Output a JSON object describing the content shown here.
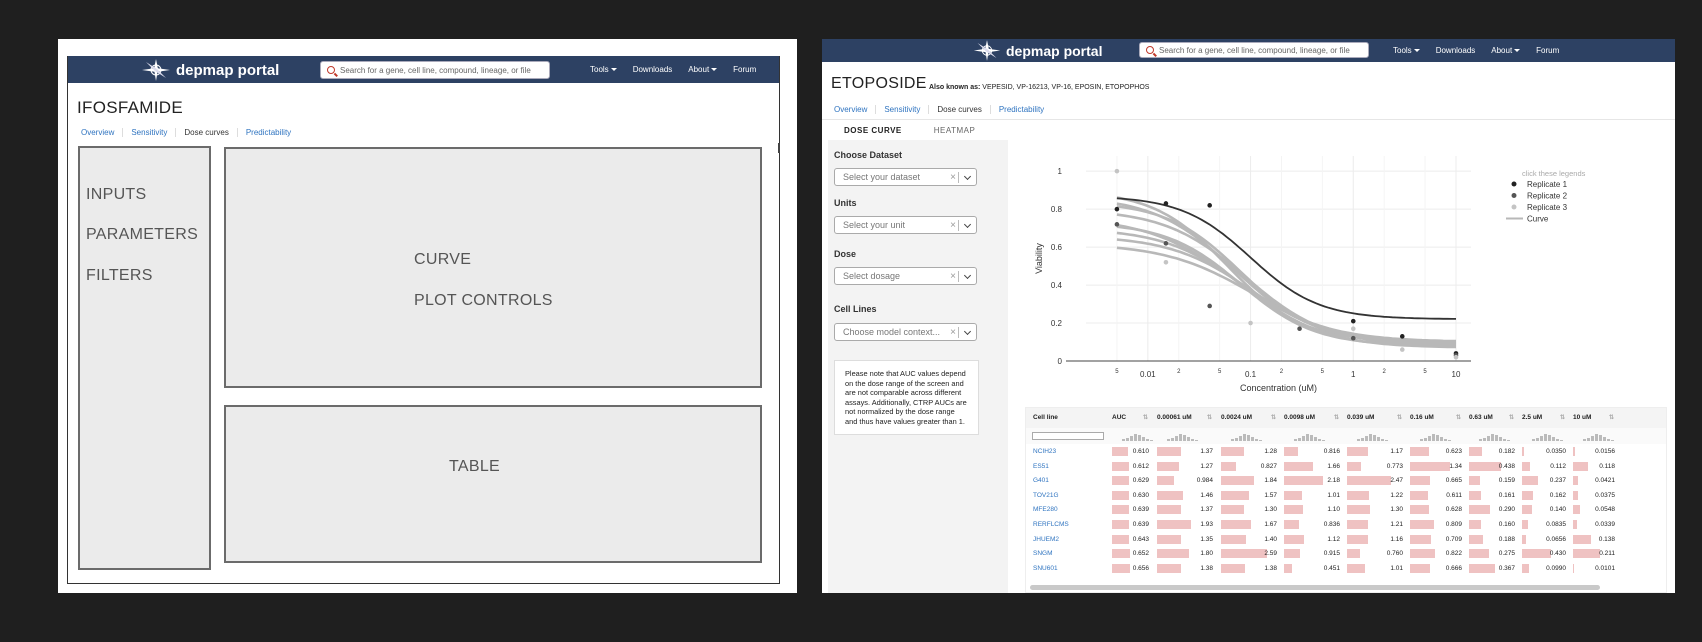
{
  "left": {
    "brand": "depmap portal",
    "search_placeholder": "Search for a gene, cell line, compound, lineage, or file",
    "nav": [
      "Tools",
      "Downloads",
      "About",
      "Forum"
    ],
    "title": "IFOSFAMIDE",
    "tabs": [
      "Overview",
      "Sensitivity",
      "Dose curves",
      "Predictability"
    ],
    "active_tab": "Dose curves",
    "wireframe": {
      "sidebar_labels": [
        "INPUTS",
        "PARAMETERS",
        "FILTERS"
      ],
      "curve_labels": [
        "CURVE",
        "PLOT CONTROLS"
      ],
      "table_label": "TABLE"
    }
  },
  "right": {
    "brand": "depmap portal",
    "search_placeholder": "Search for a gene, cell line, compound, lineage, or file",
    "nav": [
      "Tools",
      "Downloads",
      "About",
      "Forum"
    ],
    "title": "ETOPOSIDE",
    "also_known_label": "Also known as:",
    "also_known_value": "VEPESID, VP-16213, VP-16, EPOSIN, ETOPOPHOS",
    "tabs": [
      "Overview",
      "Sensitivity",
      "Dose curves",
      "Predictability"
    ],
    "subtabs": [
      "DOSE CURVE",
      "HEATMAP"
    ],
    "fields": [
      {
        "label": "Choose Dataset",
        "placeholder": "Select your dataset"
      },
      {
        "label": "Units",
        "placeholder": "Select your unit"
      },
      {
        "label": "Dose",
        "placeholder": "Select dosage"
      },
      {
        "label": "Cell Lines",
        "placeholder": "Choose model context..."
      }
    ],
    "note": "Please note that AUC values depend on the dose range of the screen and are not comparable across different assays. Additionally, CTRP AUCs are not normalized by the dose range and thus have values greater than 1.",
    "table": {
      "headers": [
        "Cell line",
        "AUC",
        "0.00061 uM",
        "0.0024 uM",
        "0.0098 uM",
        "0.039 uM",
        "0.16 uM",
        "0.63 uM",
        "2.5 uM",
        "10 uM"
      ],
      "rows": [
        {
          "name": "NCIH23",
          "values": [
            "0.610",
            "1.37",
            "1.28",
            "0.816",
            "1.17",
            "0.623",
            "0.182",
            "0.0350",
            "0.0156"
          ]
        },
        {
          "name": "ES51",
          "values": [
            "0.612",
            "1.27",
            "0.827",
            "1.66",
            "0.773",
            "1.34",
            "0.438",
            "0.112",
            "0.118"
          ]
        },
        {
          "name": "G401",
          "values": [
            "0.629",
            "0.984",
            "1.84",
            "2.18",
            "2.47",
            "0.665",
            "0.159",
            "0.237",
            "0.0421"
          ]
        },
        {
          "name": "TOV21G",
          "values": [
            "0.630",
            "1.46",
            "1.57",
            "1.01",
            "1.22",
            "0.611",
            "0.161",
            "0.162",
            "0.0375"
          ]
        },
        {
          "name": "MFE280",
          "values": [
            "0.639",
            "1.37",
            "1.30",
            "1.10",
            "1.30",
            "0.628",
            "0.290",
            "0.140",
            "0.0548"
          ]
        },
        {
          "name": "RERFLCMS",
          "values": [
            "0.639",
            "1.93",
            "1.67",
            "0.836",
            "1.21",
            "0.809",
            "0.160",
            "0.0835",
            "0.0339"
          ]
        },
        {
          "name": "JHUEM2",
          "values": [
            "0.643",
            "1.35",
            "1.40",
            "1.12",
            "1.16",
            "0.709",
            "0.188",
            "0.0656",
            "0.138"
          ]
        },
        {
          "name": "SNGM",
          "values": [
            "0.652",
            "1.80",
            "2.59",
            "0.915",
            "0.760",
            "0.822",
            "0.275",
            "0.430",
            "0.211"
          ]
        },
        {
          "name": "SNU601",
          "values": [
            "0.656",
            "1.38",
            "1.38",
            "0.451",
            "1.01",
            "0.666",
            "0.367",
            "0.0990",
            "0.0101"
          ]
        }
      ]
    }
  },
  "chart_data": {
    "type": "line",
    "title": "",
    "xlabel": "Concentration (uM)",
    "ylabel": "Viability",
    "x_scale": "log",
    "xlim": [
      0.0025,
      14
    ],
    "ylim": [
      0,
      1.08
    ],
    "y_ticks": [
      "0",
      "0.2",
      "0.4",
      "0.6",
      "0.8",
      "1"
    ],
    "x_major_ticks": [
      "0.01",
      "0.1",
      "1",
      "10"
    ],
    "x_minor_labels": [
      "5",
      "2",
      "5",
      "2",
      "5",
      "2",
      "5"
    ],
    "legend_hint": "click these legends",
    "legend": [
      "Replicate 1",
      "Replicate 2",
      "Replicate 3",
      "Curve"
    ],
    "legend_position": "top-right",
    "grid": true,
    "curves": [
      {
        "top": 0.87,
        "bottom": 0.22,
        "ec50": 0.1,
        "hill": 1.3,
        "highlight": true
      },
      {
        "top": 0.9,
        "bottom": 0.1,
        "ec50": 0.06,
        "hill": 1.2
      },
      {
        "top": 0.87,
        "bottom": 0.09,
        "ec50": 0.07,
        "hill": 1.1
      },
      {
        "top": 0.84,
        "bottom": 0.1,
        "ec50": 0.08,
        "hill": 1.2
      },
      {
        "top": 0.8,
        "bottom": 0.08,
        "ec50": 0.09,
        "hill": 1.1
      },
      {
        "top": 0.76,
        "bottom": 0.1,
        "ec50": 0.07,
        "hill": 1.0
      },
      {
        "top": 0.73,
        "bottom": 0.08,
        "ec50": 0.08,
        "hill": 1.2
      },
      {
        "top": 0.7,
        "bottom": 0.07,
        "ec50": 0.09,
        "hill": 1.1
      },
      {
        "top": 0.66,
        "bottom": 0.09,
        "ec50": 0.1,
        "hill": 1.1
      },
      {
        "top": 0.62,
        "bottom": 0.08,
        "ec50": 0.11,
        "hill": 1.0
      }
    ],
    "points": [
      {
        "x": 0.005,
        "y": 1.0,
        "rep": 3
      },
      {
        "x": 0.005,
        "y": 0.8,
        "rep": 1
      },
      {
        "x": 0.005,
        "y": 0.72,
        "rep": 2
      },
      {
        "x": 0.015,
        "y": 0.83,
        "rep": 1
      },
      {
        "x": 0.015,
        "y": 0.62,
        "rep": 2
      },
      {
        "x": 0.015,
        "y": 0.52,
        "rep": 3
      },
      {
        "x": 0.04,
        "y": 0.82,
        "rep": 1
      },
      {
        "x": 0.04,
        "y": 0.29,
        "rep": 2
      },
      {
        "x": 0.1,
        "y": 0.2,
        "rep": 3
      },
      {
        "x": 0.3,
        "y": 0.17,
        "rep": 2
      },
      {
        "x": 1.0,
        "y": 0.21,
        "rep": 1
      },
      {
        "x": 1.0,
        "y": 0.17,
        "rep": 3
      },
      {
        "x": 1.0,
        "y": 0.12,
        "rep": 2
      },
      {
        "x": 3.0,
        "y": 0.13,
        "rep": 1
      },
      {
        "x": 3.0,
        "y": 0.06,
        "rep": 3
      },
      {
        "x": 10.0,
        "y": 0.04,
        "rep": 1
      },
      {
        "x": 10.0,
        "y": 0.03,
        "rep": 2
      },
      {
        "x": 10.0,
        "y": 0.02,
        "rep": 3
      }
    ],
    "colors": {
      "rep1": "#222222",
      "rep2": "#555555",
      "rep3": "#c4c4c4",
      "curve": "#b8b8b8",
      "highlight": "#333333"
    }
  },
  "colors": {
    "navbar": "#2d4163",
    "link": "#2f74c0",
    "bar": "#efc2c2"
  }
}
